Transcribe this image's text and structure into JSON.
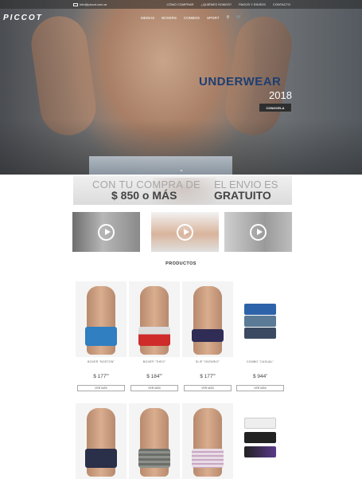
{
  "topbar": {
    "email": "info@piccot.com.ar",
    "links": [
      "CÓMO COMPRAR",
      "¿QUIÉNES SOMOS?",
      "PAGOS Y ENVÍOS",
      "CONTACTO"
    ]
  },
  "brand": "PICCOT",
  "nav": {
    "items": [
      "MEDIAS",
      "BOXERS",
      "COMBOS",
      "SPORT"
    ],
    "icons": [
      "search-icon",
      "cart-icon"
    ]
  },
  "hero": {
    "headline": "UNDERWEAR",
    "year": "2018",
    "cta": "CONOCELA",
    "headline_color": "#1d3e73"
  },
  "promo": {
    "line1": "CON TU COMPRA DE",
    "line2": "$ 850 o MÁS",
    "line3": "EL ENVIO ES",
    "line4": "GRATUITO"
  },
  "videos": [
    "play-icon",
    "play-icon",
    "play-icon"
  ],
  "products": {
    "title": "PRODUCTOS",
    "items": [
      {
        "name": "BOXER \"BOSTON\"",
        "price": "$ 177",
        "cents": "00",
        "button": "VER MÁS",
        "color": "#2f7fc1"
      },
      {
        "name": "BOXER \"THEO\"",
        "price": "$ 184",
        "cents": "50",
        "button": "VER MÁS",
        "color": "#cf2b2b"
      },
      {
        "name": "SLIP \"ONTARIO\"",
        "price": "$ 177",
        "cents": "00",
        "button": "VER MÁS",
        "color": "#2f2c55"
      },
      {
        "name": "COMBO \"CASUAL\"",
        "price": "$ 944",
        "cents": "0",
        "button": "VER MÁS",
        "color": "#2d63a8"
      }
    ],
    "row2": [
      {
        "color": "#2a2f4a"
      },
      {
        "color": "#6b6e68"
      },
      {
        "color": "#e9dbe6"
      },
      {
        "color": "#222222"
      }
    ]
  }
}
